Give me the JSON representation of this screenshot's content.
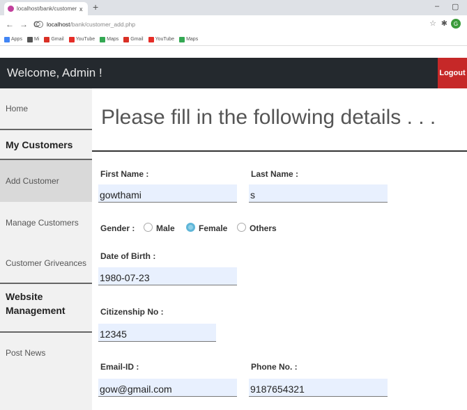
{
  "browser": {
    "tab_title": "localhost/bank/customer_add.p",
    "tab_close": "x",
    "new_tab": "+",
    "window_min": "–",
    "window_max": "▢",
    "nav_back": "←",
    "nav_forward": "→",
    "nav_reload": "C",
    "url_host": "localhost",
    "url_path": "/bank/customer_add.php",
    "profile_initial": "G",
    "bookmarks": [
      {
        "label": "Apps",
        "icon": "apps-grid-icon",
        "color": "#4285f4"
      },
      {
        "label": "Mi",
        "icon": "globe-icon",
        "color": "#555555"
      },
      {
        "label": "Gmail",
        "icon": "gmail-icon",
        "color": "#d93025"
      },
      {
        "label": "YouTube",
        "icon": "youtube-icon",
        "color": "#e52d27"
      },
      {
        "label": "Maps",
        "icon": "maps-icon",
        "color": "#34a853"
      },
      {
        "label": "Gmail",
        "icon": "gmail-icon",
        "color": "#d93025"
      },
      {
        "label": "YouTube",
        "icon": "youtube-icon",
        "color": "#e52d27"
      },
      {
        "label": "Maps",
        "icon": "maps-icon",
        "color": "#34a853"
      }
    ]
  },
  "header": {
    "welcome": "Welcome, Admin !",
    "logout_label": "Logout",
    "accent_color": "#c62828"
  },
  "sidebar": {
    "home": "Home",
    "section_customers": "My Customers",
    "add_customer": "Add Customer",
    "manage_customers": "Manage Customers",
    "customer_grievances": "Customer Griveances",
    "section_website": "Website Management",
    "post_news": "Post News"
  },
  "form": {
    "title": "Please fill in the following details . . .",
    "first_name_label": "First Name :",
    "first_name_value": "gowthami",
    "last_name_label": "Last Name :",
    "last_name_value": "s",
    "gender_label": "Gender :",
    "gender_options": [
      "Male",
      "Female",
      "Others"
    ],
    "gender_selected": "Female",
    "dob_label": "Date of Birth :",
    "dob_value": "1980-07-23",
    "citizenship_label": "Citizenship No :",
    "citizenship_value": "12345",
    "email_label": "Email-ID :",
    "email_value": "gow@gmail.com",
    "phone_label": "Phone No. :",
    "phone_value": "9187654321"
  }
}
